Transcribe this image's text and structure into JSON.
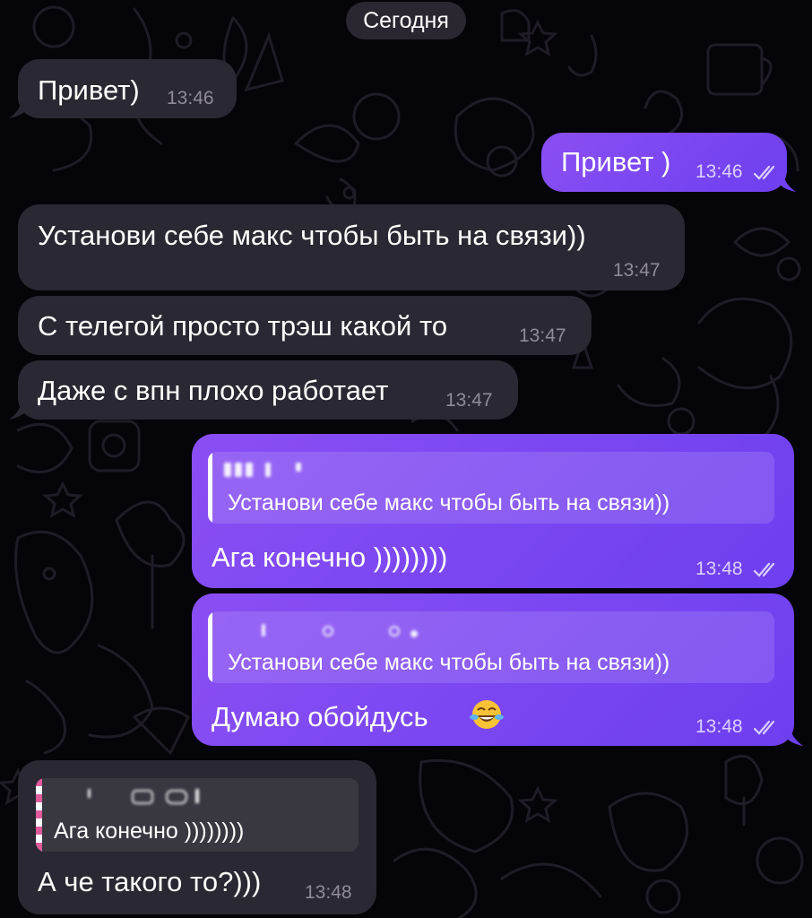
{
  "date_separator": "Сегодня",
  "messages": [
    {
      "direction": "in",
      "text": "Привет)",
      "time": "13:46"
    },
    {
      "direction": "out",
      "text": "Привет )",
      "time": "13:46",
      "status": "read"
    },
    {
      "direction": "in",
      "text": "Установи себе макс чтобы быть на связи))",
      "time": "13:47"
    },
    {
      "direction": "in",
      "text": "С телегой просто трэш какой то",
      "time": "13:47"
    },
    {
      "direction": "in",
      "text": "Даже с впн плохо работает",
      "time": "13:47"
    },
    {
      "direction": "out",
      "reply_to": "Установи себе макс чтобы быть на связи))",
      "text": "Ага конечно ))))))))",
      "time": "13:48",
      "status": "read"
    },
    {
      "direction": "out",
      "reply_to": "Установи себе макс чтобы быть на связи))",
      "text": "Думаю обойдусь",
      "emoji": "face-with-tears-of-joy",
      "time": "13:48",
      "status": "read"
    },
    {
      "direction": "in",
      "reply_to": "Ага конечно ))))))))",
      "text": "А че такого то?)))",
      "time": "13:48"
    }
  ],
  "colors": {
    "background": "#050408",
    "incoming_bubble": "#2a2832",
    "outgoing_bubble": "#7a46f2",
    "doodle": "#1f1c26"
  },
  "icons": [
    "double-check-icon",
    "face-with-tears-of-joy-emoji"
  ]
}
